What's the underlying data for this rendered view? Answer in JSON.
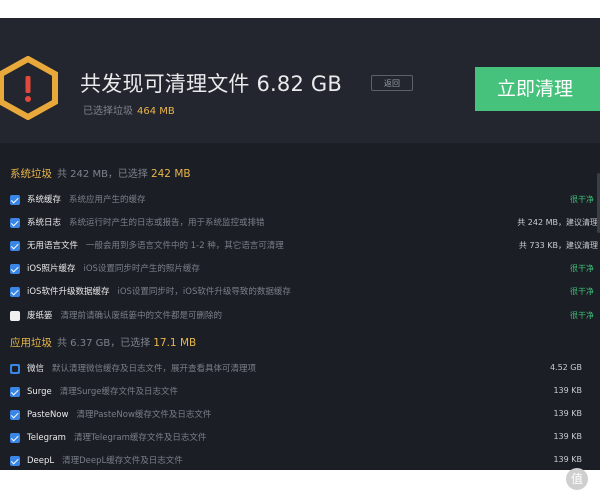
{
  "header": {
    "title": "共发现可清理文件 6.82 GB",
    "return_label": "返回",
    "selected_prefix": "已选择垃圾",
    "selected_value": "464 MB",
    "clean_label": "立即清理"
  },
  "system_junk": {
    "title": "系统垃圾",
    "summary": "共 242 MB，已选择",
    "selected": "242 MB",
    "items": [
      {
        "name": "系统缓存",
        "desc": "系统应用产生的缓存",
        "right": "很干净",
        "checked": true
      },
      {
        "name": "系统日志",
        "desc": "系统运行时产生的日志或报告，用于系统监控或排错",
        "right": "共 242 MB，建议清理",
        "checked": true
      },
      {
        "name": "无用语言文件",
        "desc": "一般会用到多语言文件中的 1-2 种，其它语言可清理",
        "right": "共 733 KB，建议清理",
        "checked": true
      },
      {
        "name": "iOS照片缓存",
        "desc": "iOS设置同步时产生的照片缓存",
        "right": "很干净",
        "checked": true
      },
      {
        "name": "iOS软件升级数据缓存",
        "desc": "iOS设置同步时，iOS软件升级导致的数据缓存",
        "right": "很干净",
        "checked": true
      },
      {
        "name": "废纸篓",
        "desc": "清理前请确认废纸篓中的文件都是可删除的",
        "right": "很干净",
        "checked": false
      }
    ]
  },
  "app_junk": {
    "title": "应用垃圾",
    "summary": "共 6.37 GB，已选择",
    "selected": "17.1 MB",
    "items": [
      {
        "name": "微信",
        "desc": "默认清理微信缓存及日志文件，展开查看具体可清理项",
        "right": "4.52 GB",
        "state": "partial"
      },
      {
        "name": "Surge",
        "desc": "清理Surge缓存文件及日志文件",
        "right": "139 KB",
        "state": "checked"
      },
      {
        "name": "PasteNow",
        "desc": "清理PasteNow缓存文件及日志文件",
        "right": "139 KB",
        "state": "checked"
      },
      {
        "name": "Telegram",
        "desc": "清理Telegram缓存文件及日志文件",
        "right": "139 KB",
        "state": "checked"
      },
      {
        "name": "DeepL",
        "desc": "清理DeepL缓存文件及日志文件",
        "right": "139 KB",
        "state": "checked"
      }
    ]
  },
  "watermark": {
    "glyph": "值"
  },
  "colors": {
    "accent_green": "#47c27d",
    "highlight": "#e9b54a",
    "checkbox_blue": "#3a86e6"
  }
}
